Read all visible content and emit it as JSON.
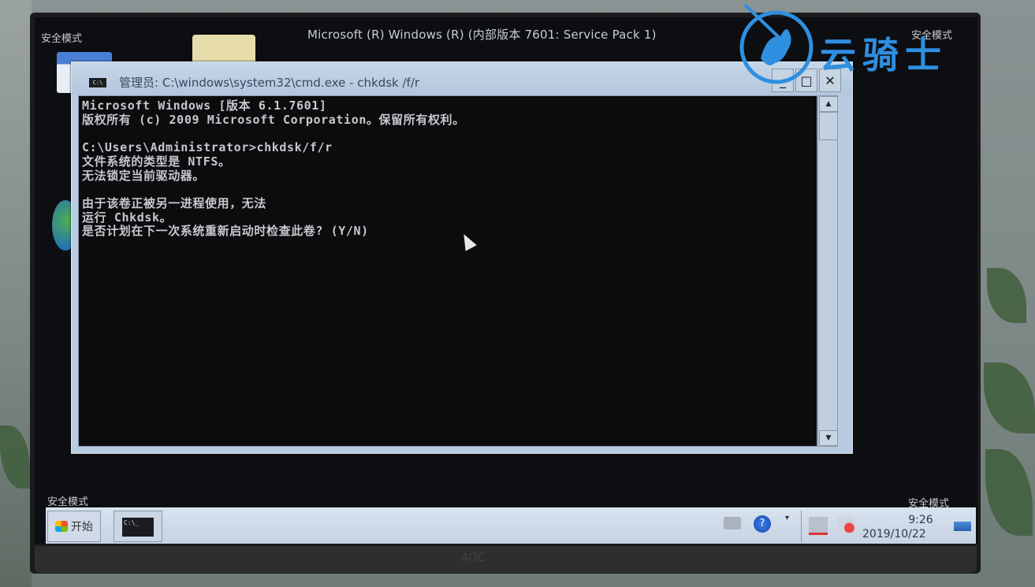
{
  "screen": {
    "safe_mode_label": "安全模式",
    "os_banner": "Microsoft (R) Windows (R) (内部版本 7601: Service Pack 1)"
  },
  "cmd_window": {
    "title": "管理员: C:\\windows\\system32\\cmd.exe - chkdsk /f/r",
    "icon_label": "C:\\",
    "buttons": {
      "minimize": "_",
      "maximize": "□",
      "close": "✕"
    },
    "console_lines": [
      "Microsoft Windows [版本 6.1.7601]",
      "版权所有 (c) 2009 Microsoft Corporation。保留所有权利。",
      "",
      "C:\\Users\\Administrator>chkdsk/f/r",
      "文件系统的类型是 NTFS。",
      "无法锁定当前驱动器。",
      "",
      "由于该卷正被另一进程使用，无法",
      "运行 Chkdsk。",
      "是否计划在下一次系统重新启动时检查此卷? (Y/N)"
    ],
    "scroll": {
      "up": "▲",
      "down": "▼"
    }
  },
  "taskbar": {
    "start_label": "开始",
    "task_cmd_label": "C:\\_",
    "clock": {
      "time": "9:26",
      "date": "2019/10/22"
    }
  },
  "watermark": {
    "text": "云骑士"
  },
  "monitor": {
    "brand": "AOC"
  }
}
